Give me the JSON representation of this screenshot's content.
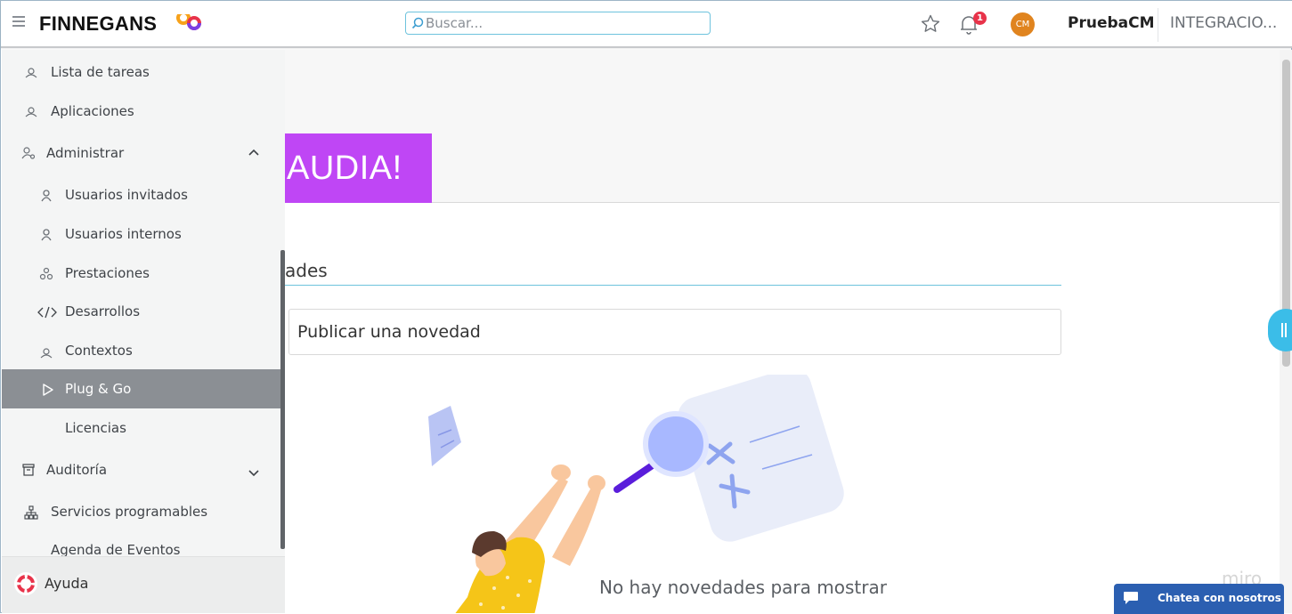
{
  "header": {
    "logo_text": "FINNEGANS",
    "search_placeholder": "Buscar...",
    "notification_count": "1",
    "avatar_initials": "CM",
    "username": "PruebaCM",
    "company": "INTEGRACIO..."
  },
  "sidebar": {
    "items": [
      {
        "label": "Lista de tareas",
        "icon": "tasks-icon"
      },
      {
        "label": "Aplicaciones",
        "icon": "apps-icon"
      },
      {
        "label": "Administrar",
        "icon": "admin-user-icon",
        "expanded": true
      },
      {
        "label": "Usuarios invitados",
        "icon": "user-icon"
      },
      {
        "label": "Usuarios internos",
        "icon": "user-icon"
      },
      {
        "label": "Prestaciones",
        "icon": "modules-icon"
      },
      {
        "label": "Desarrollos",
        "icon": "code-icon"
      },
      {
        "label": "Contextos",
        "icon": "context-icon"
      },
      {
        "label": "Plug & Go",
        "icon": "play-icon",
        "active": true
      },
      {
        "label": "Licencias",
        "icon": ""
      },
      {
        "label": "Auditoría",
        "icon": "archive-icon",
        "expanded": false
      },
      {
        "label": "Servicios programables",
        "icon": "sitemap-icon"
      },
      {
        "label": "Agenda de Eventos",
        "icon": ""
      }
    ],
    "help_label": "Ayuda"
  },
  "main": {
    "banner_text": "AUDIA!",
    "section_title": "ades",
    "post_placeholder": "Publicar una novedad",
    "empty_message": "No hay novedades para mostrar",
    "watermark": "miro"
  },
  "chat": {
    "label": "Chatea con nosotros"
  },
  "colors": {
    "accent": "#6ec3dd",
    "banner_purple": "#bf46f5",
    "active_item": "#8b8f94",
    "chat_blue": "#2b5fb1",
    "badge_red": "#e8334a",
    "avatar_orange": "#e0841f"
  }
}
